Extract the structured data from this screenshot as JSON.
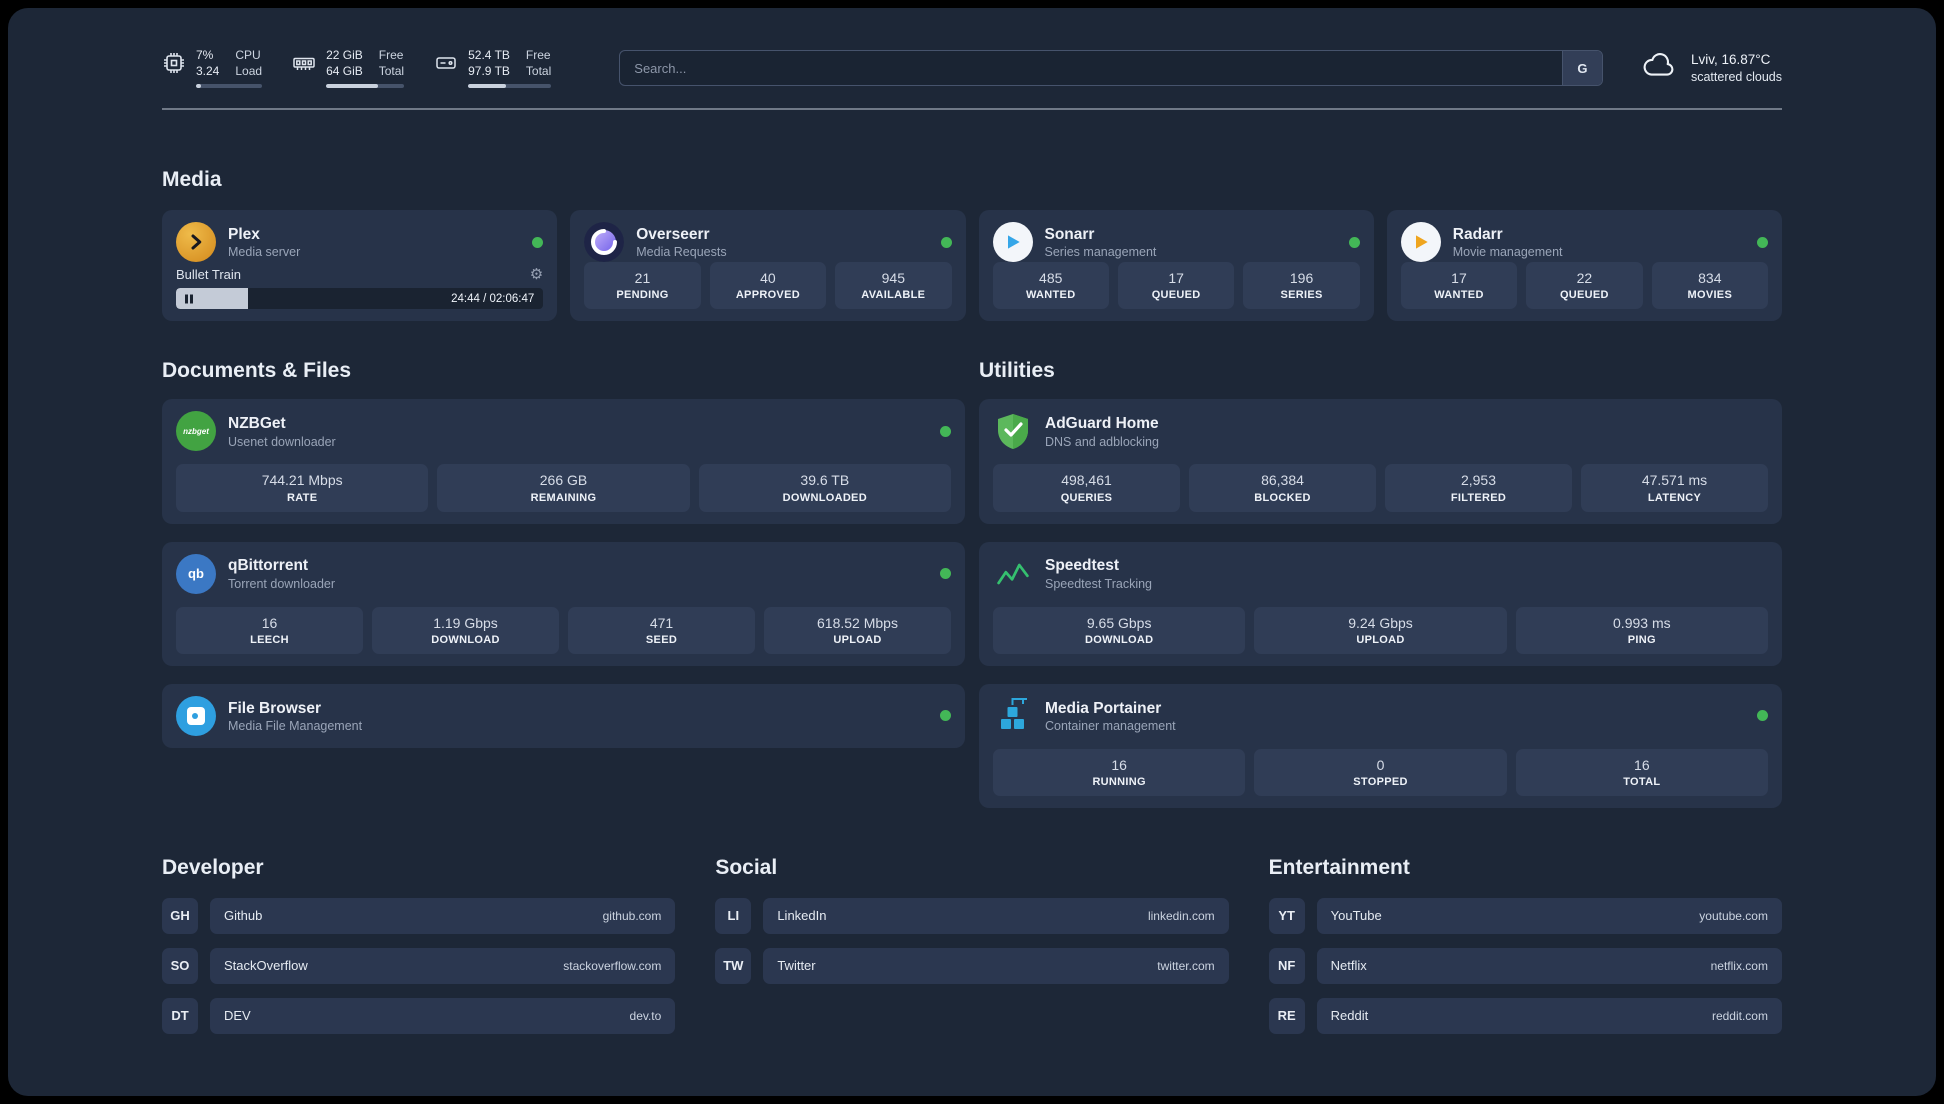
{
  "topbar": {
    "cpu": {
      "value1": "7%",
      "value2": "3.24",
      "label1": "CPU",
      "label2": "Load",
      "progress": 7
    },
    "ram": {
      "value1": "22 GiB",
      "value2": "64 GiB",
      "label1": "Free",
      "label2": "Total",
      "progress": 66
    },
    "disk": {
      "value1": "52.4 TB",
      "value2": "97.9 TB",
      "label1": "Free",
      "label2": "Total",
      "progress": 46
    },
    "search": {
      "placeholder": "Search...",
      "engine_label": "G"
    },
    "weather": {
      "location": "Lviv, 16.87°C",
      "condition": "scattered clouds"
    }
  },
  "icons": {
    "gear": "⚙"
  },
  "sections": {
    "media": "Media",
    "documents": "Documents & Files",
    "utilities": "Utilities",
    "developer": "Developer",
    "social": "Social",
    "entertainment": "Entertainment"
  },
  "apps": {
    "plex": {
      "name": "Plex",
      "desc": "Media server",
      "player": {
        "title": "Bullet Train",
        "time": "24:44 / 02:06:47",
        "progress": 19.5
      }
    },
    "overseerr": {
      "name": "Overseerr",
      "desc": "Media Requests",
      "stats": [
        {
          "value": "21",
          "label": "PENDING"
        },
        {
          "value": "40",
          "label": "APPROVED"
        },
        {
          "value": "945",
          "label": "AVAILABLE"
        }
      ]
    },
    "sonarr": {
      "name": "Sonarr",
      "desc": "Series management",
      "stats": [
        {
          "value": "485",
          "label": "WANTED"
        },
        {
          "value": "17",
          "label": "QUEUED"
        },
        {
          "value": "196",
          "label": "SERIES"
        }
      ]
    },
    "radarr": {
      "name": "Radarr",
      "desc": "Movie management",
      "stats": [
        {
          "value": "17",
          "label": "WANTED"
        },
        {
          "value": "22",
          "label": "QUEUED"
        },
        {
          "value": "834",
          "label": "MOVIES"
        }
      ]
    },
    "nzbget": {
      "name": "NZBGet",
      "desc": "Usenet downloader",
      "icon_text": "nzbget",
      "stats": [
        {
          "value": "744.21 Mbps",
          "label": "RATE"
        },
        {
          "value": "266 GB",
          "label": "REMAINING"
        },
        {
          "value": "39.6 TB",
          "label": "DOWNLOADED"
        }
      ]
    },
    "qbittorrent": {
      "name": "qBittorrent",
      "desc": "Torrent downloader",
      "icon_text": "qb",
      "stats": [
        {
          "value": "16",
          "label": "LEECH"
        },
        {
          "value": "1.19 Gbps",
          "label": "DOWNLOAD"
        },
        {
          "value": "471",
          "label": "SEED"
        },
        {
          "value": "618.52 Mbps",
          "label": "UPLOAD"
        }
      ]
    },
    "filebrowser": {
      "name": "File Browser",
      "desc": "Media File Management"
    },
    "adguard": {
      "name": "AdGuard Home",
      "desc": "DNS and adblocking",
      "stats": [
        {
          "value": "498,461",
          "label": "QUERIES"
        },
        {
          "value": "86,384",
          "label": "BLOCKED"
        },
        {
          "value": "2,953",
          "label": "FILTERED"
        },
        {
          "value": "47.571 ms",
          "label": "LATENCY"
        }
      ]
    },
    "speedtest": {
      "name": "Speedtest",
      "desc": "Speedtest Tracking",
      "stats": [
        {
          "value": "9.65 Gbps",
          "label": "DOWNLOAD"
        },
        {
          "value": "9.24 Gbps",
          "label": "UPLOAD"
        },
        {
          "value": "0.993 ms",
          "label": "PING"
        }
      ]
    },
    "portainer": {
      "name": "Media Portainer",
      "desc": "Container management",
      "stats": [
        {
          "value": "16",
          "label": "RUNNING"
        },
        {
          "value": "0",
          "label": "STOPPED"
        },
        {
          "value": "16",
          "label": "TOTAL"
        }
      ]
    }
  },
  "bookmarks": {
    "developer": [
      {
        "abbr": "GH",
        "name": "Github",
        "url": "github.com"
      },
      {
        "abbr": "SO",
        "name": "StackOverflow",
        "url": "stackoverflow.com"
      },
      {
        "abbr": "DT",
        "name": "DEV",
        "url": "dev.to"
      }
    ],
    "social": [
      {
        "abbr": "LI",
        "name": "LinkedIn",
        "url": "linkedin.com"
      },
      {
        "abbr": "TW",
        "name": "Twitter",
        "url": "twitter.com"
      }
    ],
    "entertainment": [
      {
        "abbr": "YT",
        "name": "YouTube",
        "url": "youtube.com"
      },
      {
        "abbr": "NF",
        "name": "Netflix",
        "url": "netflix.com"
      },
      {
        "abbr": "RE",
        "name": "Reddit",
        "url": "reddit.com"
      }
    ]
  }
}
